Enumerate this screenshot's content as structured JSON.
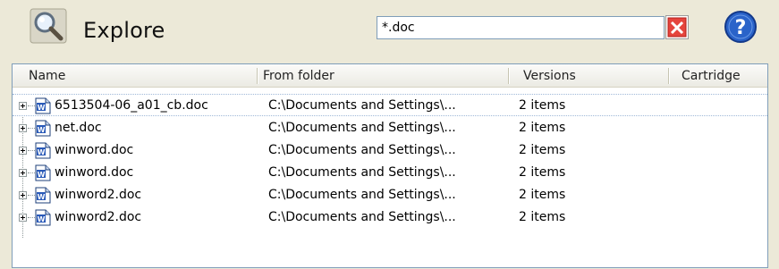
{
  "header": {
    "title": "Explore",
    "search_value": "*.doc",
    "icons": {
      "explore": "magnifier-icon",
      "clear": "clear-x-icon",
      "help": "help-icon"
    }
  },
  "columns": [
    "Name",
    "From folder",
    "Versions",
    "Cartridge"
  ],
  "rows": [
    {
      "name": "6513504-06_a01_cb.doc",
      "folder": "C:\\Documents and Settings\\...",
      "versions": "2 items",
      "cartridge": ""
    },
    {
      "name": "net.doc",
      "folder": "C:\\Documents and Settings\\...",
      "versions": "2 items",
      "cartridge": ""
    },
    {
      "name": "winword.doc",
      "folder": "C:\\Documents and Settings\\...",
      "versions": "2 items",
      "cartridge": ""
    },
    {
      "name": "winword.doc",
      "folder": "C:\\Documents and Settings\\...",
      "versions": "2 items",
      "cartridge": ""
    },
    {
      "name": "winword2.doc",
      "folder": "C:\\Documents and Settings\\...",
      "versions": "2 items",
      "cartridge": ""
    },
    {
      "name": "winword2.doc",
      "folder": "C:\\Documents and Settings\\...",
      "versions": "2 items",
      "cartridge": ""
    }
  ],
  "colors": {
    "background": "#ece9d8",
    "panel_border": "#7f9db9",
    "help_blue": "#2a63c9",
    "clear_red": "#d8242a"
  }
}
